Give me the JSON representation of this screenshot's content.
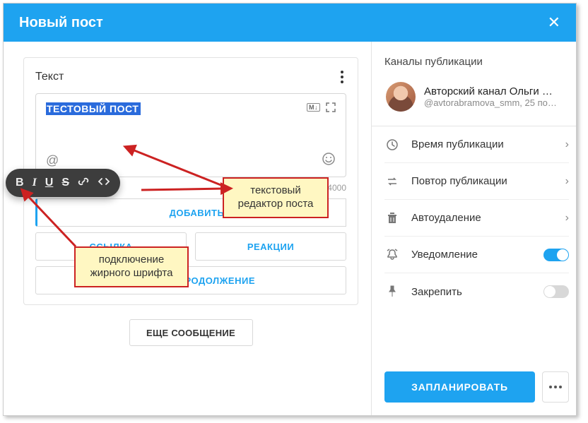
{
  "header": {
    "title": "Новый пост"
  },
  "card": {
    "label": "Текст",
    "selected_text": "ТЕСТОВЫЙ ПОСТ",
    "md_badge": "M↓",
    "counter": "13 / 4000"
  },
  "toolbar": {
    "bold": "B",
    "italic": "I",
    "underline": "U",
    "strike": "S"
  },
  "buttons": {
    "add_photo": "ДОБАВИТЬ ФОТО",
    "link": "ССЫЛКА",
    "reactions": "РЕАКЦИИ",
    "hidden_continue": "СКРЫТОЕ ПРОДОЛЖЕНИЕ",
    "more_message": "ЕЩЕ СООБЩЕНИЕ"
  },
  "callouts": {
    "editor": "текстовый редактор поста",
    "bold_connect": "подключение жирного шрифта"
  },
  "right": {
    "section": "Каналы публикации",
    "channel_name": "Авторский канал Ольги …",
    "channel_sub": "@avtorabramova_smm, 25 по…",
    "rows": {
      "time": "Время публикации",
      "repeat": "Повтор публикации",
      "autodelete": "Автоудаление",
      "notify": "Уведомление",
      "pin": "Закрепить"
    },
    "schedule": "ЗАПЛАНИРОВАТЬ"
  }
}
